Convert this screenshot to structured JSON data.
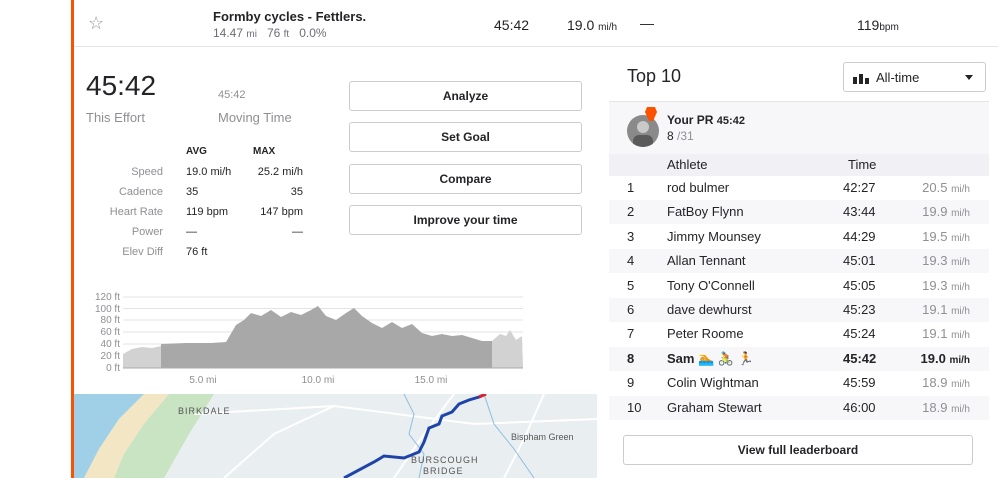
{
  "colors": {
    "accent": "#fc5200",
    "route": "#1e44aa",
    "elevation_fill": "#a8a8a8",
    "elevation_fill_light": "#d2d2d2"
  },
  "segment": {
    "name": "Formby cycles - Fettlers.",
    "distance": "14.47",
    "distance_unit": "mi",
    "elev": "76",
    "elev_unit": "ft",
    "grade": "0.0%",
    "time": "45:42",
    "speed": "19.0",
    "speed_unit": "mi/h",
    "power": "—",
    "hr": "119",
    "hr_unit": "bpm"
  },
  "effort": {
    "elapsed": "45:42",
    "elapsed_label": "This Effort",
    "moving": "45:42",
    "moving_label": "Moving Time",
    "avg_header": "AVG",
    "max_header": "MAX",
    "stats": [
      {
        "label": "Speed",
        "avg": "19.0 mi/h",
        "max": "25.2 mi/h"
      },
      {
        "label": "Cadence",
        "avg": "35",
        "max": "35"
      },
      {
        "label": "Heart Rate",
        "avg": "119 bpm",
        "max": "147 bpm"
      },
      {
        "label": "Power",
        "avg": "—",
        "max": "—"
      },
      {
        "label": "Elev Diff",
        "avg": "76 ft",
        "max": ""
      }
    ]
  },
  "actions": {
    "analyze": "Analyze",
    "set_goal": "Set Goal",
    "compare": "Compare",
    "improve": "Improve your time"
  },
  "elevation": {
    "y_ticks": [
      "120 ft",
      "100 ft",
      "80 ft",
      "60 ft",
      "40 ft",
      "20 ft",
      "0 ft"
    ],
    "x_ticks": [
      "5.0 mi",
      "10.0 mi",
      "15.0 mi"
    ]
  },
  "map": {
    "labels": {
      "birkdale": "BIRKDALE",
      "bispham": "Bispham Green",
      "burscough1": "BURSCOUGH",
      "burscough2": "BRIDGE"
    }
  },
  "leaderboard": {
    "title": "Top 10",
    "filter": "All-time",
    "pr": {
      "title": "Your PR",
      "time": "45:42",
      "rank": "8",
      "of": "/31"
    },
    "headers": {
      "athlete": "Athlete",
      "time": "Time"
    },
    "rows": [
      {
        "rank": "1",
        "name": "rod bulmer",
        "time": "42:27",
        "speed": "20.5",
        "unit": "mi/h"
      },
      {
        "rank": "2",
        "name": "FatBoy Flynn",
        "time": "43:44",
        "speed": "19.9",
        "unit": "mi/h"
      },
      {
        "rank": "3",
        "name": "Jimmy Mounsey",
        "time": "44:29",
        "speed": "19.5",
        "unit": "mi/h"
      },
      {
        "rank": "4",
        "name": "Allan Tennant",
        "time": "45:01",
        "speed": "19.3",
        "unit": "mi/h"
      },
      {
        "rank": "5",
        "name": "Tony O'Connell",
        "time": "45:05",
        "speed": "19.3",
        "unit": "mi/h"
      },
      {
        "rank": "6",
        "name": "dave dewhurst",
        "time": "45:23",
        "speed": "19.1",
        "unit": "mi/h"
      },
      {
        "rank": "7",
        "name": "Peter Roome",
        "time": "45:24",
        "speed": "19.1",
        "unit": "mi/h"
      },
      {
        "rank": "8",
        "name": "Sam 🏊 🚴 🏃",
        "time": "45:42",
        "speed": "19.0",
        "unit": "mi/h"
      },
      {
        "rank": "9",
        "name": "Colin Wightman",
        "time": "45:59",
        "speed": "18.9",
        "unit": "mi/h"
      },
      {
        "rank": "10",
        "name": "Graham Stewart",
        "time": "46:00",
        "speed": "18.9",
        "unit": "mi/h"
      }
    ],
    "view_full": "View full leaderboard"
  }
}
